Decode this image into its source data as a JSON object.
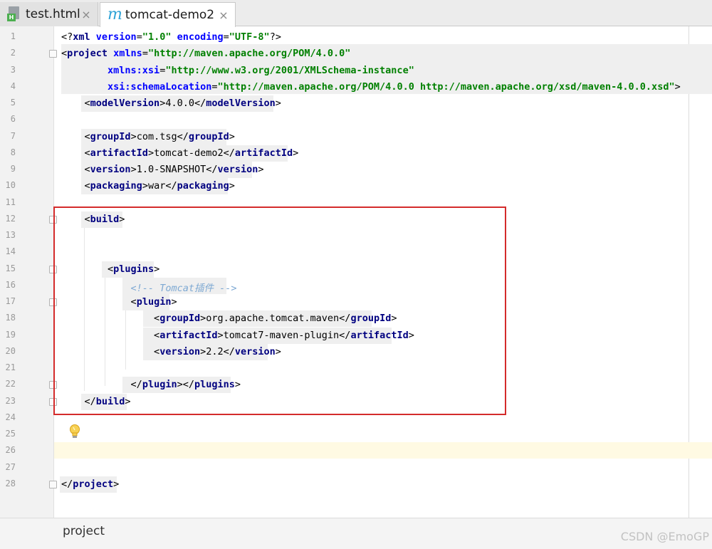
{
  "tabs": [
    {
      "label": "test.html",
      "icon": "html-file-icon",
      "active": false
    },
    {
      "label": "tomcat-demo2",
      "icon": "maven-m-icon",
      "active": true
    }
  ],
  "close_glyph": "×",
  "lines": [
    {
      "n": "1",
      "parts": [
        [
          "pi",
          "<?"
        ],
        [
          "tag",
          "xml "
        ],
        [
          "attr",
          "version"
        ],
        [
          "br",
          "="
        ],
        [
          "val",
          "\"1.0\" "
        ],
        [
          "attr",
          "encoding"
        ],
        [
          "br",
          "="
        ],
        [
          "val",
          "\"UTF-8\""
        ],
        [
          "pi",
          "?>"
        ]
      ]
    },
    {
      "n": "2",
      "parts": [
        [
          "br",
          "<"
        ],
        [
          "tag",
          "project "
        ],
        [
          "attr",
          "xmlns"
        ],
        [
          "br",
          "="
        ],
        [
          "val",
          "\"http://maven.apache.org/POM/4.0.0\""
        ]
      ]
    },
    {
      "n": "3",
      "parts": [
        [
          "txt",
          "        "
        ],
        [
          "attr",
          "xmlns:xsi"
        ],
        [
          "br",
          "="
        ],
        [
          "val",
          "\"http://www.w3.org/2001/XMLSchema-instance\""
        ]
      ]
    },
    {
      "n": "4",
      "parts": [
        [
          "txt",
          "        "
        ],
        [
          "attr",
          "xsi:schemaLocation"
        ],
        [
          "br",
          "="
        ],
        [
          "val",
          "\"http://maven.apache.org/POM/4.0.0 http://maven.apache.org/xsd/maven-4.0.0.xsd\""
        ],
        [
          "br",
          ">"
        ]
      ]
    },
    {
      "n": "5",
      "parts": [
        [
          "txt",
          "    "
        ],
        [
          "br",
          "<"
        ],
        [
          "tag",
          "modelVersion"
        ],
        [
          "br",
          ">"
        ],
        [
          "txt",
          "4.0.0"
        ],
        [
          "br",
          "</"
        ],
        [
          "tag",
          "modelVersion"
        ],
        [
          "br",
          ">"
        ]
      ]
    },
    {
      "n": "6",
      "parts": []
    },
    {
      "n": "7",
      "parts": [
        [
          "txt",
          "    "
        ],
        [
          "br",
          "<"
        ],
        [
          "tag",
          "groupId"
        ],
        [
          "br",
          ">"
        ],
        [
          "txt",
          "com.tsg"
        ],
        [
          "br",
          "</"
        ],
        [
          "tag",
          "groupId"
        ],
        [
          "br",
          ">"
        ]
      ]
    },
    {
      "n": "8",
      "parts": [
        [
          "txt",
          "    "
        ],
        [
          "br",
          "<"
        ],
        [
          "tag",
          "artifactId"
        ],
        [
          "br",
          ">"
        ],
        [
          "txt",
          "tomcat-demo2"
        ],
        [
          "br",
          "</"
        ],
        [
          "tag",
          "artifactId"
        ],
        [
          "br",
          ">"
        ]
      ]
    },
    {
      "n": "9",
      "parts": [
        [
          "txt",
          "    "
        ],
        [
          "br",
          "<"
        ],
        [
          "tag",
          "version"
        ],
        [
          "br",
          ">"
        ],
        [
          "txt",
          "1.0-SNAPSHOT"
        ],
        [
          "br",
          "</"
        ],
        [
          "tag",
          "version"
        ],
        [
          "br",
          ">"
        ]
      ]
    },
    {
      "n": "10",
      "parts": [
        [
          "txt",
          "    "
        ],
        [
          "br",
          "<"
        ],
        [
          "tag",
          "packaging"
        ],
        [
          "br",
          ">"
        ],
        [
          "txt",
          "war"
        ],
        [
          "br",
          "</"
        ],
        [
          "tag",
          "packaging"
        ],
        [
          "br",
          ">"
        ]
      ]
    },
    {
      "n": "11",
      "parts": []
    },
    {
      "n": "12",
      "parts": [
        [
          "txt",
          "    "
        ],
        [
          "br",
          "<"
        ],
        [
          "tag",
          "build"
        ],
        [
          "br",
          ">"
        ]
      ]
    },
    {
      "n": "13",
      "parts": []
    },
    {
      "n": "14",
      "parts": []
    },
    {
      "n": "15",
      "parts": [
        [
          "txt",
          "        "
        ],
        [
          "br",
          "<"
        ],
        [
          "tag",
          "plugins"
        ],
        [
          "br",
          ">"
        ]
      ]
    },
    {
      "n": "16",
      "parts": [
        [
          "txt",
          "            "
        ],
        [
          "cmt",
          "<!-- Tomcat插件 -->"
        ]
      ]
    },
    {
      "n": "17",
      "parts": [
        [
          "txt",
          "            "
        ],
        [
          "br",
          "<"
        ],
        [
          "tag",
          "plugin"
        ],
        [
          "br",
          ">"
        ]
      ]
    },
    {
      "n": "18",
      "parts": [
        [
          "txt",
          "                "
        ],
        [
          "br",
          "<"
        ],
        [
          "tag",
          "groupId"
        ],
        [
          "br",
          ">"
        ],
        [
          "txt",
          "org.apache.tomcat.maven"
        ],
        [
          "br",
          "</"
        ],
        [
          "tag",
          "groupId"
        ],
        [
          "br",
          ">"
        ]
      ]
    },
    {
      "n": "19",
      "parts": [
        [
          "txt",
          "                "
        ],
        [
          "br",
          "<"
        ],
        [
          "tag",
          "artifactId"
        ],
        [
          "br",
          ">"
        ],
        [
          "txt",
          "tomcat7-maven-plugin"
        ],
        [
          "br",
          "</"
        ],
        [
          "tag",
          "artifactId"
        ],
        [
          "br",
          ">"
        ]
      ]
    },
    {
      "n": "20",
      "parts": [
        [
          "txt",
          "                "
        ],
        [
          "br",
          "<"
        ],
        [
          "tag",
          "version"
        ],
        [
          "br",
          ">"
        ],
        [
          "txt",
          "2.2"
        ],
        [
          "br",
          "</"
        ],
        [
          "tag",
          "version"
        ],
        [
          "br",
          ">"
        ]
      ]
    },
    {
      "n": "21",
      "parts": []
    },
    {
      "n": "22",
      "parts": [
        [
          "txt",
          "            "
        ],
        [
          "br",
          "</"
        ],
        [
          "tag",
          "plugin"
        ],
        [
          "br",
          ">"
        ],
        [
          "br",
          "</"
        ],
        [
          "tag",
          "plugins"
        ],
        [
          "br",
          ">"
        ]
      ]
    },
    {
      "n": "23",
      "parts": [
        [
          "txt",
          "    "
        ],
        [
          "br",
          "</"
        ],
        [
          "tag",
          "build"
        ],
        [
          "br",
          ">"
        ]
      ]
    },
    {
      "n": "24",
      "parts": []
    },
    {
      "n": "25",
      "parts": []
    },
    {
      "n": "26",
      "parts": []
    },
    {
      "n": "27",
      "parts": []
    },
    {
      "n": "28",
      "parts": [
        [
          "br",
          "</"
        ],
        [
          "tag",
          "project"
        ],
        [
          "br",
          ">"
        ]
      ]
    }
  ],
  "breadcrumb": "project",
  "watermark": "CSDN @EmoGP"
}
